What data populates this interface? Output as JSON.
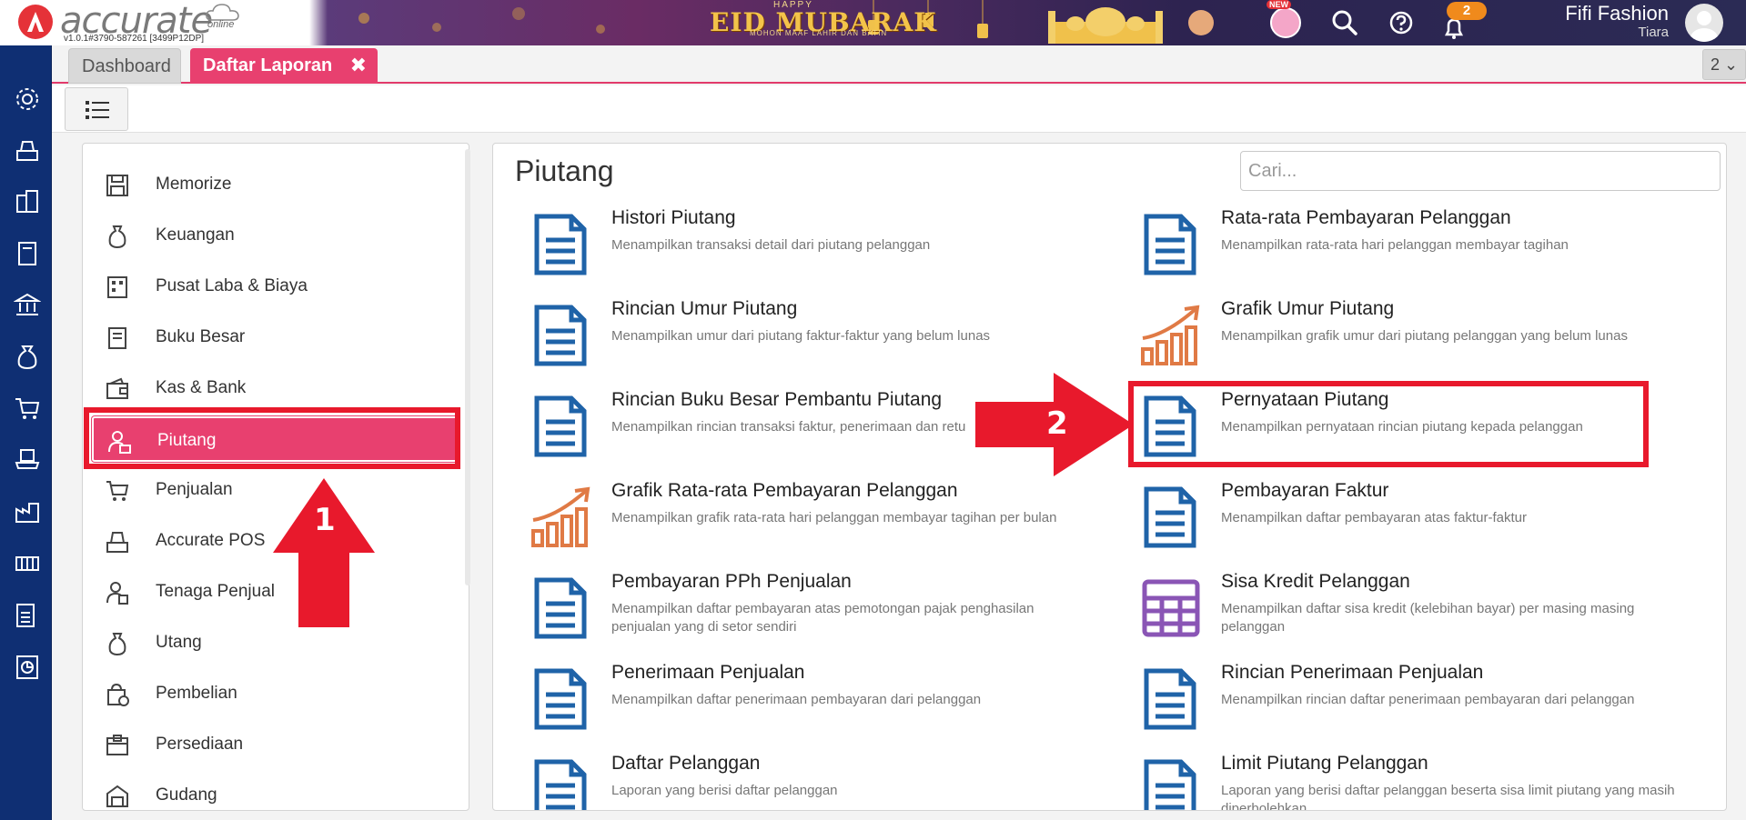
{
  "app": {
    "logo_text": "accurate",
    "logo_sub": "online",
    "version": "v1.0.1#3790-587261 [3499P12DP]",
    "banner_happy": "HAPPY",
    "banner_title": "EID MUBARAK",
    "banner_sub": "MOHON MAAF LAHIR DAN BATIN",
    "new_badge": "NEW",
    "notification_count": "2",
    "company": "Fifi Fashion",
    "user": "Tiara"
  },
  "tabs": {
    "dashboard": "Dashboard",
    "active": "Daftar Laporan",
    "close_glyph": "✖",
    "counter": "2 ⌄"
  },
  "left_menu": [
    {
      "label": "Memorize",
      "icon": "floppy-icon"
    },
    {
      "label": "Keuangan",
      "icon": "money-bag-icon"
    },
    {
      "label": "Pusat Laba & Biaya",
      "icon": "building-icon"
    },
    {
      "label": "Buku Besar",
      "icon": "ledger-icon"
    },
    {
      "label": "Kas & Bank",
      "icon": "wallet-icon"
    },
    {
      "label": "Piutang",
      "icon": "receivable-icon",
      "active": true
    },
    {
      "label": "Penjualan",
      "icon": "cart-icon"
    },
    {
      "label": "Accurate POS",
      "icon": "pos-icon"
    },
    {
      "label": "Tenaga Penjual",
      "icon": "salesperson-icon"
    },
    {
      "label": "Utang",
      "icon": "debt-bag-icon"
    },
    {
      "label": "Pembelian",
      "icon": "purchase-bag-icon"
    },
    {
      "label": "Persediaan",
      "icon": "inventory-icon"
    },
    {
      "label": "Gudang",
      "icon": "warehouse-icon"
    }
  ],
  "main": {
    "title": "Piutang",
    "search_placeholder": "Cari...",
    "reports": [
      {
        "title": "Histori Piutang",
        "desc": "Menampilkan transaksi detail dari piutang pelanggan",
        "icon": "document-icon"
      },
      {
        "title": "Rata-rata Pembayaran Pelanggan",
        "desc": "Menampilkan rata-rata hari pelanggan membayar tagihan",
        "icon": "document-icon"
      },
      {
        "title": "Rincian Umur Piutang",
        "desc": "Menampilkan umur dari piutang faktur-faktur yang belum lunas",
        "icon": "document-icon"
      },
      {
        "title": "Grafik Umur Piutang",
        "desc": "Menampilkan grafik umur dari piutang pelanggan yang belum lunas",
        "icon": "growth-chart-icon"
      },
      {
        "title": "Rincian Buku Besar Pembantu Piutang",
        "desc": "Menampilkan rincian transaksi faktur, penerimaan dan retu",
        "icon": "document-icon"
      },
      {
        "title": "Pernyataan Piutang",
        "desc": "Menampilkan pernyataan rincian piutang kepada pelanggan",
        "icon": "document-icon"
      },
      {
        "title": "Grafik Rata-rata Pembayaran Pelanggan",
        "desc": "Menampilkan grafik rata-rata hari pelanggan membayar tagihan per bulan",
        "icon": "growth-chart-icon"
      },
      {
        "title": "Pembayaran Faktur",
        "desc": "Menampilkan daftar pembayaran atas faktur-faktur",
        "icon": "document-icon"
      },
      {
        "title": "Pembayaran PPh Penjualan",
        "desc": "Menampilkan daftar pembayaran atas pemotongan pajak penghasilan penjualan yang di setor sendiri",
        "icon": "document-icon"
      },
      {
        "title": "Sisa Kredit Pelanggan",
        "desc": "Menampilkan daftar sisa kredit (kelebihan bayar) per masing masing pelanggan",
        "icon": "grid-table-icon"
      },
      {
        "title": "Penerimaan Penjualan",
        "desc": "Menampilkan daftar penerimaan pembayaran dari pelanggan",
        "icon": "document-icon"
      },
      {
        "title": "Rincian Penerimaan Penjualan",
        "desc": "Menampilkan rincian daftar penerimaan pembayaran dari pelanggan",
        "icon": "document-icon"
      },
      {
        "title": "Daftar Pelanggan",
        "desc": "Laporan yang berisi daftar pelanggan",
        "icon": "document-icon"
      },
      {
        "title": "Limit Piutang Pelanggan",
        "desc": "Laporan yang berisi daftar pelanggan beserta sisa limit piutang yang masih diperbolehkan",
        "icon": "document-icon"
      }
    ]
  },
  "annotations": {
    "step1": "1",
    "step2": "2",
    "color": "#e8192c"
  },
  "colors": {
    "accent": "#e8406f",
    "nav": "#0f2f73",
    "doc_icon": "#1f63a8",
    "chart_icon": "#e07a45",
    "grid_icon": "#8a55b5"
  }
}
